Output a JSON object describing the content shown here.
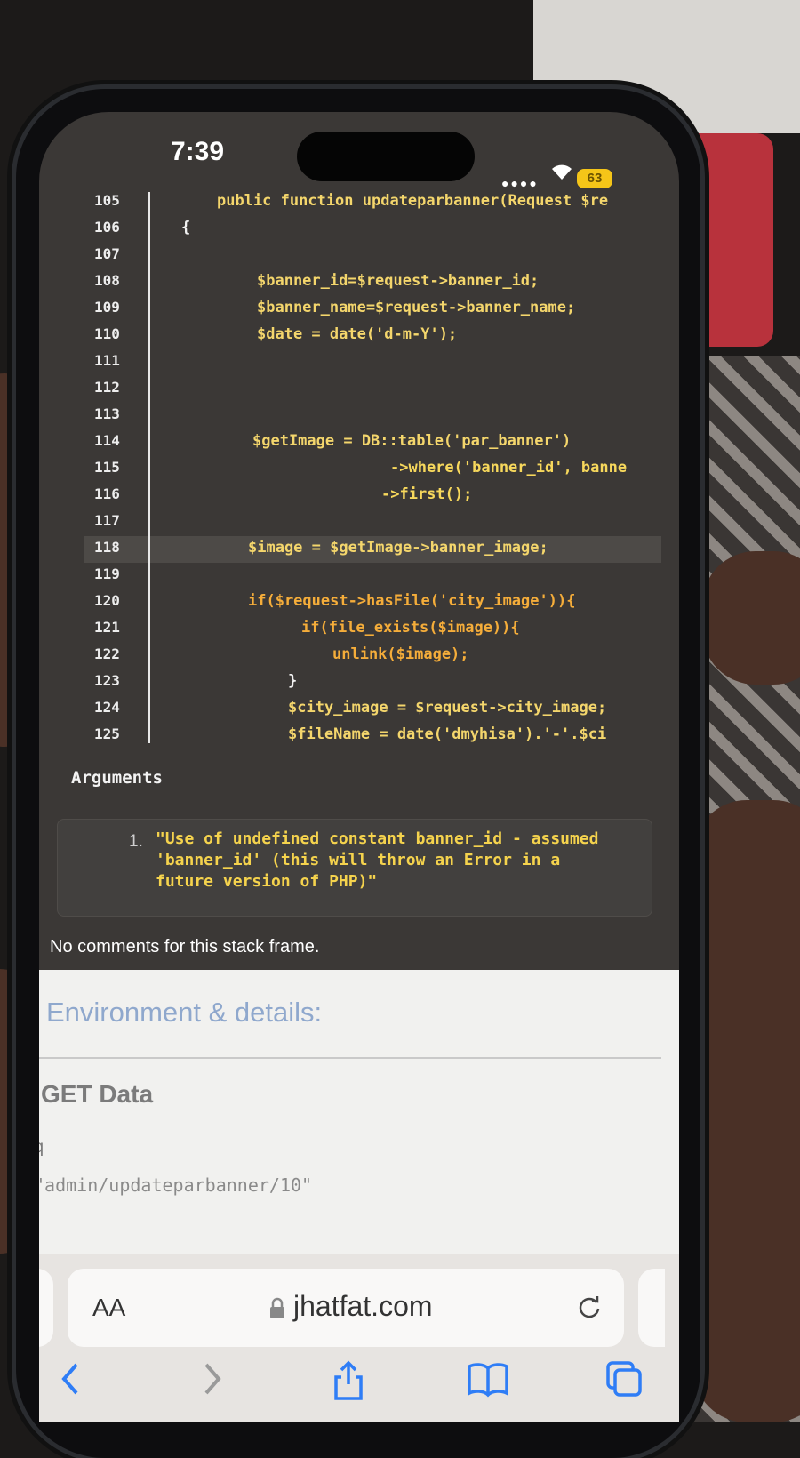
{
  "status_bar": {
    "time": "7:39",
    "battery": "63",
    "signal_icon": "signal-dots-icon",
    "wifi_icon": "wifi-icon"
  },
  "code": {
    "line_numbers": [
      "105",
      "106",
      "107",
      "108",
      "109",
      "110",
      "111",
      "112",
      "113",
      "114",
      "115",
      "116",
      "117",
      "118",
      "119",
      "120",
      "121",
      "122",
      "123",
      "124",
      "125"
    ],
    "lines": [
      "public function updateparbanner(Request $re",
      "{",
      "",
      "$banner_id=$request->banner_id;",
      "$banner_name=$request->banner_name;",
      "$date = date('d-m-Y');",
      "",
      "",
      "",
      "$getImage = DB::table('par_banner')",
      "->where('banner_id', banne",
      "->first();",
      "",
      "$image = $getImage->banner_image;",
      "",
      "if($request->hasFile('city_image')){",
      "if(file_exists($image)){",
      "unlink($image);",
      "}",
      "$city_image = $request->city_image;",
      "$fileName = date('dmyhisa').'-'.$ci"
    ],
    "highlighted_line": "115"
  },
  "arguments": {
    "title": "Arguments",
    "items": [
      {
        "num": "1.",
        "text": "\"Use of undefined constant banner_id - assumed 'banner_id' (this will throw an Error in a future version of PHP)\""
      }
    ]
  },
  "comments": "No comments for this stack frame.",
  "environment": {
    "title": "Environment & details:",
    "get_title": "GET Data",
    "get_key": "q",
    "get_value": "\"admin/updateparbanner/10\""
  },
  "safari": {
    "aa_label": "AA",
    "domain": "jhatfat.com",
    "icons": [
      "back-icon",
      "forward-icon",
      "share-icon",
      "bookmarks-icon",
      "tabs-icon"
    ]
  }
}
